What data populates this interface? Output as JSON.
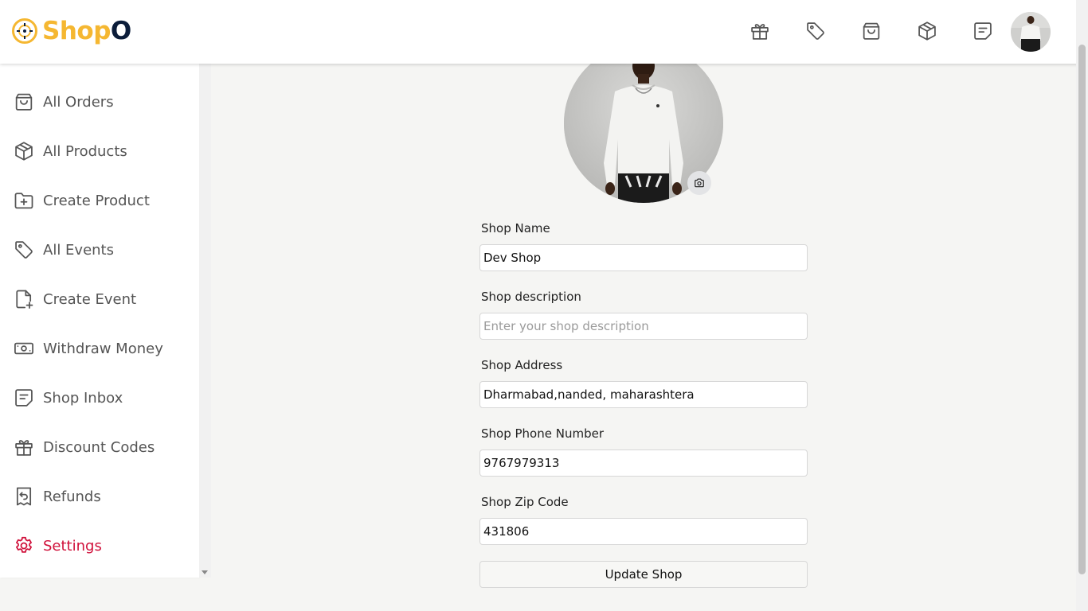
{
  "header": {
    "logo": {
      "part1": "Shop",
      "part2": "O"
    },
    "icons": [
      "gift-icon",
      "tag-icon",
      "shopping-bag-icon",
      "package-icon",
      "message-icon"
    ],
    "avatar": "user-avatar"
  },
  "sidebar": {
    "items": [
      {
        "label": "All Orders",
        "icon": "shopping-bag-icon"
      },
      {
        "label": "All Products",
        "icon": "package-icon"
      },
      {
        "label": "Create Product",
        "icon": "folder-plus-icon"
      },
      {
        "label": "All Events",
        "icon": "tag-icon"
      },
      {
        "label": "Create Event",
        "icon": "file-plus-icon"
      },
      {
        "label": "Withdraw Money",
        "icon": "money-icon"
      },
      {
        "label": "Shop Inbox",
        "icon": "message-icon"
      },
      {
        "label": "Discount Codes",
        "icon": "gift-icon"
      },
      {
        "label": "Refunds",
        "icon": "receipt-refund-icon"
      },
      {
        "label": "Settings",
        "icon": "settings-icon",
        "active": true
      }
    ],
    "active_color": "#d0103a"
  },
  "form": {
    "shop_name": {
      "label": "Shop Name",
      "value": "Dev Shop"
    },
    "shop_description": {
      "label": "Shop description",
      "value": "",
      "placeholder": "Enter your shop description"
    },
    "shop_address": {
      "label": "Shop Address",
      "value": "Dharmabad,nanded, maharashtera"
    },
    "shop_phone": {
      "label": "Shop Phone Number",
      "value": "9767979313"
    },
    "shop_zip": {
      "label": "Shop Zip Code",
      "value": "431806"
    },
    "submit_label": "Update Shop"
  },
  "colors": {
    "logo_yellow": "#f5b731",
    "logo_navy": "#0c1d3a",
    "active_red": "#d0103a",
    "background": "#f5f5f3"
  }
}
